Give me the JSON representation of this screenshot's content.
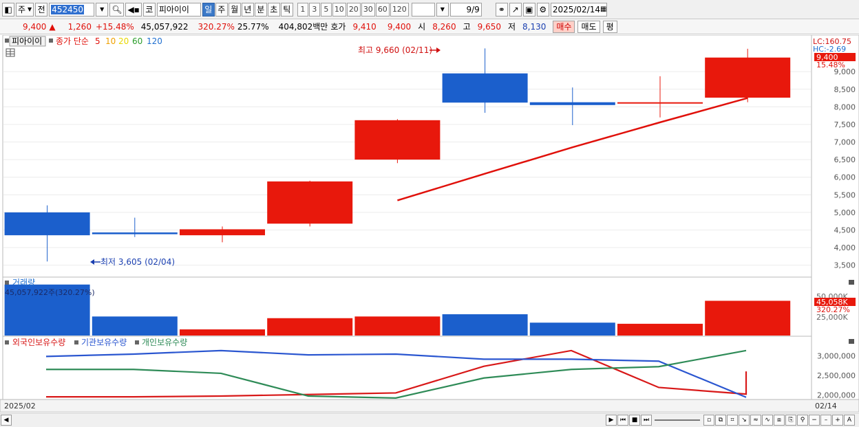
{
  "toolbar": {
    "period_label": "주",
    "jeon_label": "전",
    "stock_code": "452450",
    "market_label": "코",
    "stock_name": "피아이이",
    "period_buttons": [
      "일",
      "주",
      "월",
      "년",
      "분",
      "초",
      "틱"
    ],
    "active_period": "일",
    "interval_buttons": [
      "1",
      "3",
      "5",
      "10",
      "20",
      "30",
      "60",
      "120"
    ],
    "page_count": "9/9",
    "date": "2025/02/14"
  },
  "quote": {
    "price": "9,400",
    "up_symbol": "▲",
    "change": "1,260",
    "change_pct": "+15.48%",
    "volume": "45,057,922",
    "volume_ratio": "320.27%",
    "turnover": "25.77%",
    "amount": "404,802백만",
    "bid_label": "호가",
    "bid": "9,410",
    "ask": "9,400",
    "open_label": "시",
    "open": "8,260",
    "high_label": "고",
    "high": "9,650",
    "low_label": "저",
    "low": "8,130",
    "buy_label": "매수",
    "sell_label": "매도",
    "avg_label": "평"
  },
  "legend": {
    "name": "피아이이",
    "ma_title": "종가 단순",
    "ma_periods": [
      {
        "label": "5",
        "color": "#e0100a"
      },
      {
        "label": "10",
        "color": "#f0a000"
      },
      {
        "label": "20",
        "color": "#e8d800"
      },
      {
        "label": "60",
        "color": "#2a9d2a"
      },
      {
        "label": "120",
        "color": "#1f6fd0"
      }
    ],
    "lc": "LC:160.75",
    "hc": "HC:-2.69",
    "last_price_tag": "9,400",
    "last_pct_tag": "15.48%"
  },
  "annotations": {
    "high_text": "최고 9,660 (02/11)",
    "low_text": "최저 3,605 (02/04)"
  },
  "volume_panel": {
    "title": "거래량",
    "current": "45,057,922주(320.27%)",
    "tag": "45,058K",
    "tag_pct": "320.27%",
    "y_ticks": [
      "50,000K",
      "25,000K"
    ]
  },
  "holdings_panel": {
    "legend": [
      {
        "label": "외국인보유수량",
        "color": "#d81818"
      },
      {
        "label": "기관보유수량",
        "color": "#2a56d0"
      },
      {
        "label": "개인보유수량",
        "color": "#2e8b57"
      }
    ],
    "y_ticks": [
      "3,000,000",
      "2,500,000",
      "2,000,000"
    ]
  },
  "footer": {
    "start_date": "2025/02",
    "end_date": "02/14"
  },
  "colors": {
    "up": "#e8180c",
    "down": "#1b5fcc"
  },
  "chart_data": {
    "type": "candlestick",
    "price": {
      "candles": [
        {
          "open": 5000,
          "high": 5200,
          "low": 3605,
          "close": 4350
        },
        {
          "open": 4430,
          "high": 4850,
          "low": 4300,
          "close": 4380
        },
        {
          "open": 4350,
          "high": 4600,
          "low": 4150,
          "close": 4520
        },
        {
          "open": 4680,
          "high": 5900,
          "low": 4600,
          "close": 5880
        },
        {
          "open": 6500,
          "high": 7650,
          "low": 6400,
          "close": 7620
        },
        {
          "open": 8950,
          "high": 9660,
          "low": 7830,
          "close": 8120
        },
        {
          "open": 8130,
          "high": 8550,
          "low": 7480,
          "close": 8050
        },
        {
          "open": 8130,
          "high": 8870,
          "low": 7700,
          "close": 8130
        },
        {
          "open": 8260,
          "high": 9650,
          "low": 8130,
          "close": 9400
        }
      ],
      "ma5": [
        null,
        null,
        null,
        null,
        5340,
        6100,
        6850,
        7560,
        8250
      ],
      "ylim": [
        3200,
        10000
      ],
      "y_ticks": [
        3500,
        4000,
        4500,
        5000,
        5500,
        6000,
        6500,
        7000,
        7500,
        8000,
        8500,
        9000
      ]
    },
    "volume": {
      "values": [
        45500000,
        17000000,
        5500000,
        15500000,
        17000000,
        19000000,
        11500000,
        10500000,
        31000000
      ],
      "ylim": [
        0,
        46000000
      ]
    },
    "holdings": {
      "series": [
        {
          "name": "외국인보유수량",
          "values": [
            1950000,
            1950000,
            1970000,
            2010000,
            2050000,
            2730000,
            3130000,
            2190000,
            2020000,
            2600000
          ]
        },
        {
          "name": "기관보유수량",
          "values": [
            2980000,
            3040000,
            3130000,
            3020000,
            3040000,
            2910000,
            2910000,
            2860000,
            1940000
          ]
        },
        {
          "name": "개인보유수량",
          "values": [
            2650000,
            2650000,
            2550000,
            1970000,
            1920000,
            2430000,
            2650000,
            2720000,
            3130000
          ]
        }
      ],
      "ylim": [
        1900000,
        3250000
      ]
    }
  }
}
